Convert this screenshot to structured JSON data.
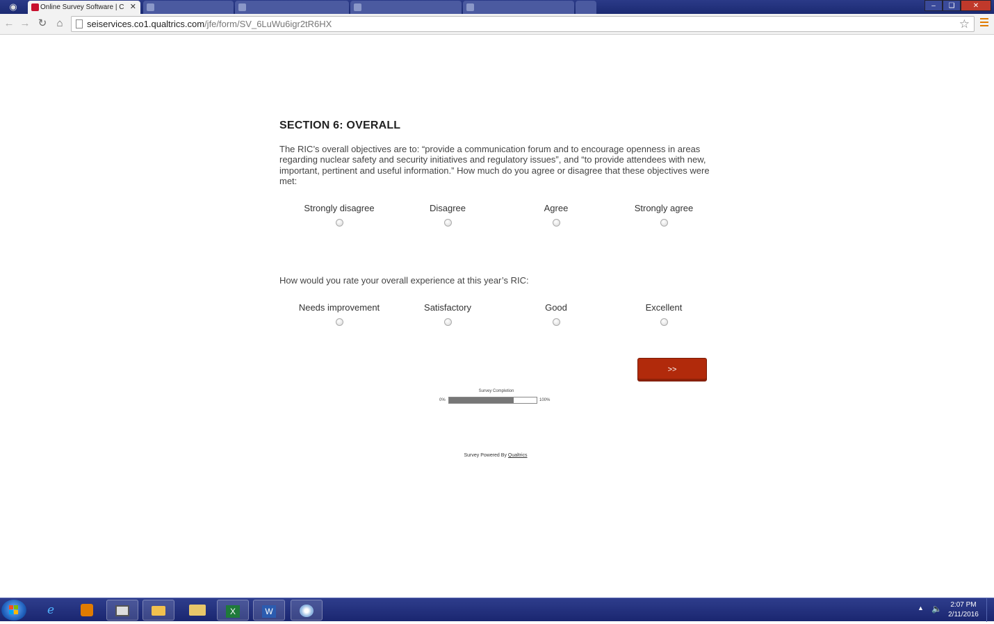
{
  "browser": {
    "active_tab_title": "Online Survey Software | C",
    "url_host": "seiservices.co1.qualtrics.com",
    "url_path": "/jfe/form/SV_6LuWu6igr2tR6HX"
  },
  "survey": {
    "section_title": "SECTION 6: OVERALL",
    "q1": {
      "text": "The RIC’s overall objectives are to: “provide a communication forum and to encourage openness in areas regarding nuclear safety and security initiatives and regulatory issues”, and “to provide attendees with new, important, pertinent and useful information.” How much do you agree or disagree that these objectives were met:",
      "choices": [
        "Strongly disagree",
        "Disagree",
        "Agree",
        "Strongly agree"
      ]
    },
    "q2": {
      "text": "How would you rate your overall experience at this year’s RIC:",
      "choices": [
        "Needs improvement",
        "Satisfactory",
        "Good",
        "Excellent"
      ]
    },
    "next_label": ">>",
    "progress": {
      "title": "Survey Completion",
      "min_label": "0%",
      "max_label": "100%",
      "value_percent": 74
    },
    "footer": {
      "prefix": "Survey Powered By",
      "link": "Qualtrics"
    }
  },
  "taskbar": {
    "time": "2:07 PM",
    "date": "2/11/2016"
  },
  "colors": {
    "next_button": "#b12a0b",
    "progress_fill": "#777777",
    "taskbar": "#1a2670"
  }
}
